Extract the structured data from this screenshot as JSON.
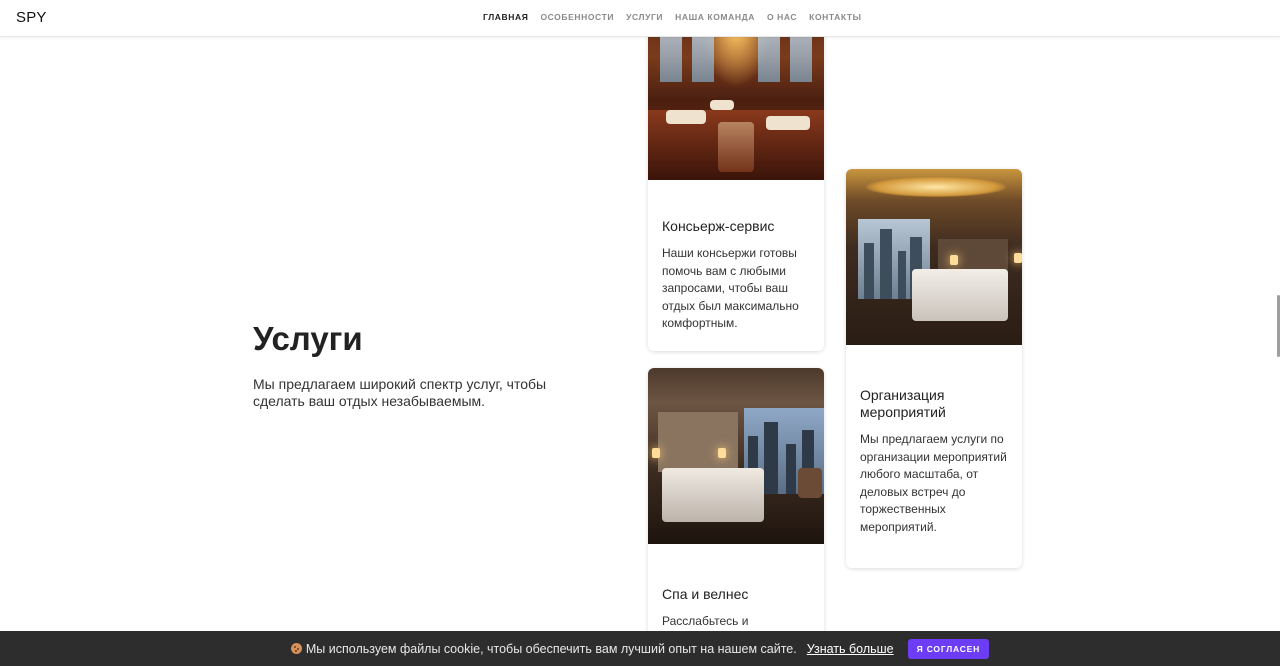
{
  "header": {
    "brand": "SPY",
    "nav": [
      {
        "label": "ГЛАВНАЯ",
        "active": true
      },
      {
        "label": "ОСОБЕННОСТИ",
        "active": false
      },
      {
        "label": "УСЛУГИ",
        "active": false
      },
      {
        "label": "НАША КОМАНДА",
        "active": false
      },
      {
        "label": "О НАС",
        "active": false
      },
      {
        "label": "КОНТАКТЫ",
        "active": false
      }
    ]
  },
  "intro": {
    "title": "Услуги",
    "text": "Мы предлагаем широкий спектр услуг, чтобы сделать ваш отдых незабываемым."
  },
  "services": [
    {
      "title": "Консьерж-сервис",
      "text": "Наши консьержи готовы помочь вам с любыми запросами, чтобы ваш отдых был максимально комфортным.",
      "image_icon": "hotel-lobby-image"
    },
    {
      "title": "Организация мероприятий",
      "text": "Мы предлагаем услуги по организации мероприятий любого масштаба, от деловых встреч до торжественных мероприятий.",
      "image_icon": "bedroom-image"
    },
    {
      "title": "Спа и велнес",
      "text": "Расслабьтесь и",
      "image_icon": "bedroom-image"
    }
  ],
  "cookie": {
    "text": "Мы используем файлы cookie, чтобы обеспечить вам лучший опыт на нашем сайте.",
    "link": "Узнать больше",
    "button": "Я СОГЛАСЕН",
    "button_color": "#6d3df6"
  }
}
